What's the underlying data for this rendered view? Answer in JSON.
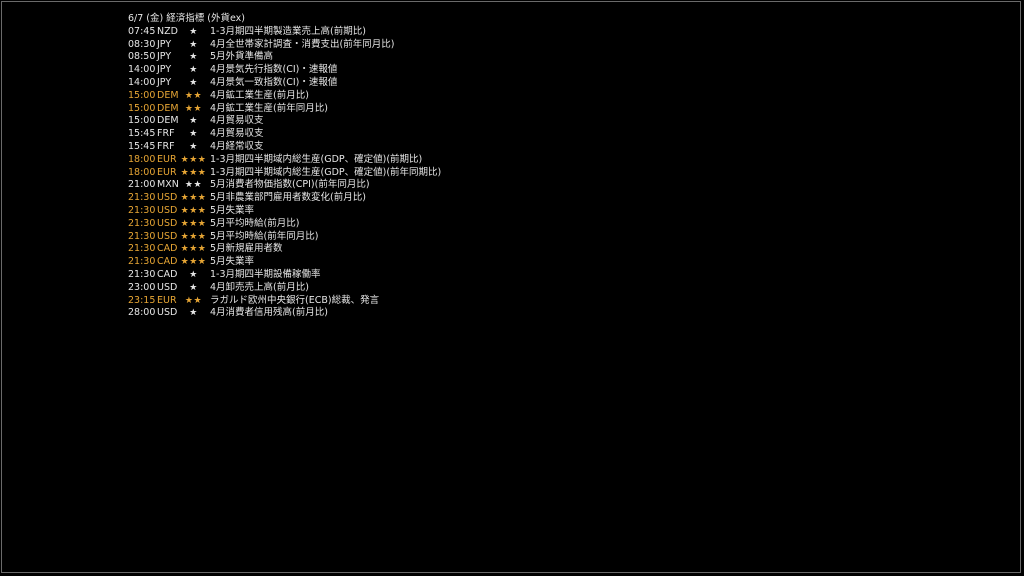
{
  "header": {
    "title": "6/7 (金) 経済指標 (外貨ex)"
  },
  "events": [
    {
      "time": "07:45",
      "currency": "NZD",
      "stars": "★",
      "name": "1-3月期四半期製造業売上高(前期比)",
      "highlight": false
    },
    {
      "time": "08:30",
      "currency": "JPY",
      "stars": "★",
      "name": "4月全世帯家計調査・消費支出(前年同月比)",
      "highlight": false
    },
    {
      "time": "08:50",
      "currency": "JPY",
      "stars": "★",
      "name": "5月外貨準備高",
      "highlight": false
    },
    {
      "time": "14:00",
      "currency": "JPY",
      "stars": "★",
      "name": "4月景気先行指数(CI)・速報値",
      "highlight": false
    },
    {
      "time": "14:00",
      "currency": "JPY",
      "stars": "★",
      "name": "4月景気一致指数(CI)・速報値",
      "highlight": false
    },
    {
      "time": "15:00",
      "currency": "DEM",
      "stars": "★★",
      "name": "4月鉱工業生産(前月比)",
      "highlight": true
    },
    {
      "time": "15:00",
      "currency": "DEM",
      "stars": "★★",
      "name": "4月鉱工業生産(前年同月比)",
      "highlight": true
    },
    {
      "time": "15:00",
      "currency": "DEM",
      "stars": "★",
      "name": "4月貿易収支",
      "highlight": false
    },
    {
      "time": "15:45",
      "currency": "FRF",
      "stars": "★",
      "name": "4月貿易収支",
      "highlight": false
    },
    {
      "time": "15:45",
      "currency": "FRF",
      "stars": "★",
      "name": "4月経常収支",
      "highlight": false
    },
    {
      "time": "18:00",
      "currency": "EUR",
      "stars": "★★★",
      "name": "1-3月期四半期域内総生産(GDP、確定値)(前期比)",
      "highlight": true
    },
    {
      "time": "18:00",
      "currency": "EUR",
      "stars": "★★★",
      "name": "1-3月期四半期域内総生産(GDP、確定値)(前年同期比)",
      "highlight": true
    },
    {
      "time": "21:00",
      "currency": "MXN",
      "stars": "★★",
      "name": "5月消費者物価指数(CPI)(前年同月比)",
      "highlight": false
    },
    {
      "time": "21:30",
      "currency": "USD",
      "stars": "★★★",
      "name": "5月非農業部門雇用者数変化(前月比)",
      "highlight": true
    },
    {
      "time": "21:30",
      "currency": "USD",
      "stars": "★★★",
      "name": "5月失業率",
      "highlight": true
    },
    {
      "time": "21:30",
      "currency": "USD",
      "stars": "★★★",
      "name": "5月平均時給(前月比)",
      "highlight": true
    },
    {
      "time": "21:30",
      "currency": "USD",
      "stars": "★★★",
      "name": "5月平均時給(前年同月比)",
      "highlight": true
    },
    {
      "time": "21:30",
      "currency": "CAD",
      "stars": "★★★",
      "name": "5月新規雇用者数",
      "highlight": true
    },
    {
      "time": "21:30",
      "currency": "CAD",
      "stars": "★★★",
      "name": "5月失業率",
      "highlight": true
    },
    {
      "time": "21:30",
      "currency": "CAD",
      "stars": "★",
      "name": "1-3月期四半期設備稼働率",
      "highlight": false
    },
    {
      "time": "23:00",
      "currency": "USD",
      "stars": "★",
      "name": "4月卸売売上高(前月比)",
      "highlight": false
    },
    {
      "time": "23:15",
      "currency": "EUR",
      "stars": "★★",
      "name": "ラガルド欧州中央銀行(ECB)総裁、発言",
      "highlight": true
    },
    {
      "time": "28:00",
      "currency": "USD",
      "stars": "★",
      "name": "4月消費者信用残高(前月比)",
      "highlight": false
    }
  ],
  "colors": {
    "background": "#000000",
    "text": "#e6e6e6",
    "highlight": "#e6a534",
    "border": "#6a6a6a"
  }
}
